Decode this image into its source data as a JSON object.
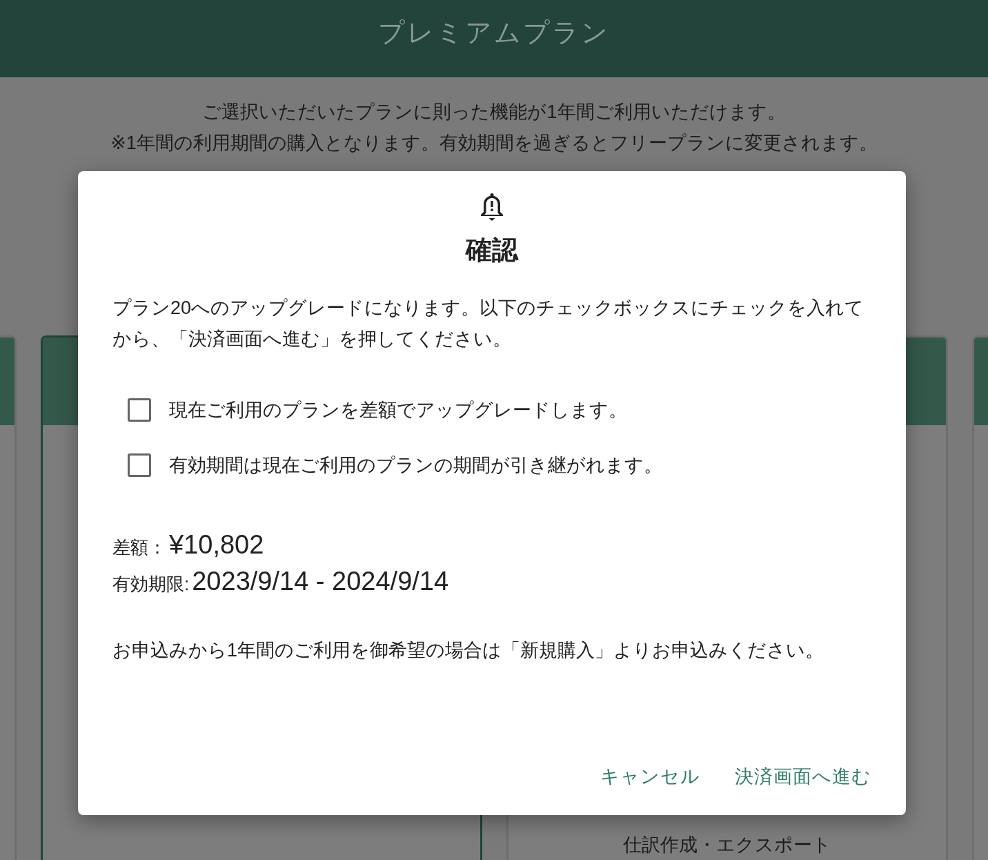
{
  "header": {
    "title": "プレミアムプラン"
  },
  "intro": [
    "ご選択いただいたプランに則った機能が1年間ご利用いただけます。",
    "※1年間の利用期間の購入となります。有効期間を過ぎるとフリープランに変更されます。"
  ],
  "plans": [
    {
      "selected": false
    },
    {
      "selected": true
    },
    {
      "selected": false,
      "features": [
        "仕訳作成・エクスポート"
      ]
    },
    {
      "selected": false
    }
  ],
  "dialog": {
    "title": "確認",
    "message": "プラン20へのアップグレードになります。以下のチェックボックスにチェックを入れてから、「決済画面へ進む」を押してください。",
    "checkboxes": [
      {
        "label": "現在ご利用のプランを差額でアップグレードします。",
        "checked": false
      },
      {
        "label": "有効期間は現在ご利用のプランの期間が引き継がれます。",
        "checked": false
      }
    ],
    "difference": {
      "label": "差額：",
      "value": "¥10,802"
    },
    "validity": {
      "label": "有効期限:",
      "value": "2023/9/14 - 2024/9/14"
    },
    "note": "お申込みから1年間のご利用を御希望の場合は「新規購入」よりお申込みください。",
    "buttons": [
      {
        "label": "キャンセル"
      },
      {
        "label": "決済画面へ進む"
      }
    ]
  }
}
